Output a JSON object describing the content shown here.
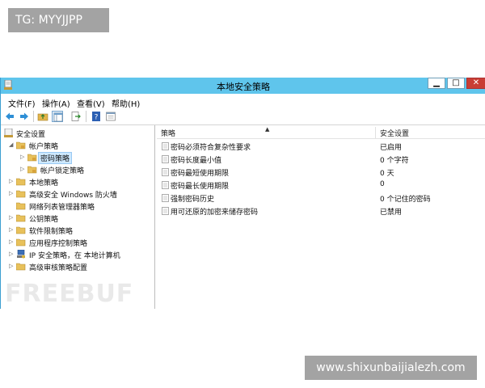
{
  "watermark_top": "TG: MYYJJPP",
  "watermark_bottom": "www.shixunbaijialezh.com",
  "watermark_logo": "FREEBUF",
  "window": {
    "title": "本地安全策略",
    "controls": {
      "minimize": "▁",
      "maximize": "□",
      "close": "✕"
    }
  },
  "menu": [
    "文件(F)",
    "操作(A)",
    "查看(V)",
    "帮助(H)"
  ],
  "toolbar": [
    "back-icon",
    "forward-icon",
    "up-folder-icon",
    "show-tree-icon",
    "export-list-icon",
    "help-icon",
    "properties-icon"
  ],
  "tree": [
    {
      "label": "安全设置",
      "twisty": "◢"
    },
    {
      "label": "帐户策略",
      "twisty": "◢"
    },
    {
      "label": "密码策略",
      "twisty": "▷",
      "selected": true
    },
    {
      "label": "帐户锁定策略",
      "twisty": "▷"
    },
    {
      "label": "本地策略",
      "twisty": "▷"
    },
    {
      "label": "高级安全 Windows 防火墙",
      "twisty": "▷"
    },
    {
      "label": "网络列表管理器策略",
      "twisty": ""
    },
    {
      "label": "公钥策略",
      "twisty": "▷"
    },
    {
      "label": "软件限制策略",
      "twisty": "▷"
    },
    {
      "label": "应用程序控制策略",
      "twisty": "▷"
    },
    {
      "label": "IP 安全策略，在 本地计算机",
      "twisty": "▷"
    },
    {
      "label": "高级审核策略配置",
      "twisty": "▷"
    }
  ],
  "list": {
    "columns": [
      "策略",
      "安全设置"
    ],
    "rows": [
      {
        "policy": "密码必须符合复杂性要求",
        "setting": "已启用"
      },
      {
        "policy": "密码长度最小值",
        "setting": "0 个字符"
      },
      {
        "policy": "密码最短使用期限",
        "setting": "0 天"
      },
      {
        "policy": "密码最长使用期限",
        "setting": "0"
      },
      {
        "policy": "强制密码历史",
        "setting": "0 个记住的密码"
      },
      {
        "policy": "用可还原的加密来储存密码",
        "setting": "已禁用"
      }
    ]
  },
  "colors": {
    "titlebar": "#5fc5ec",
    "close": "#c93d34",
    "selection": "#cde8ff",
    "watermark_box": "#a3a3a3"
  }
}
